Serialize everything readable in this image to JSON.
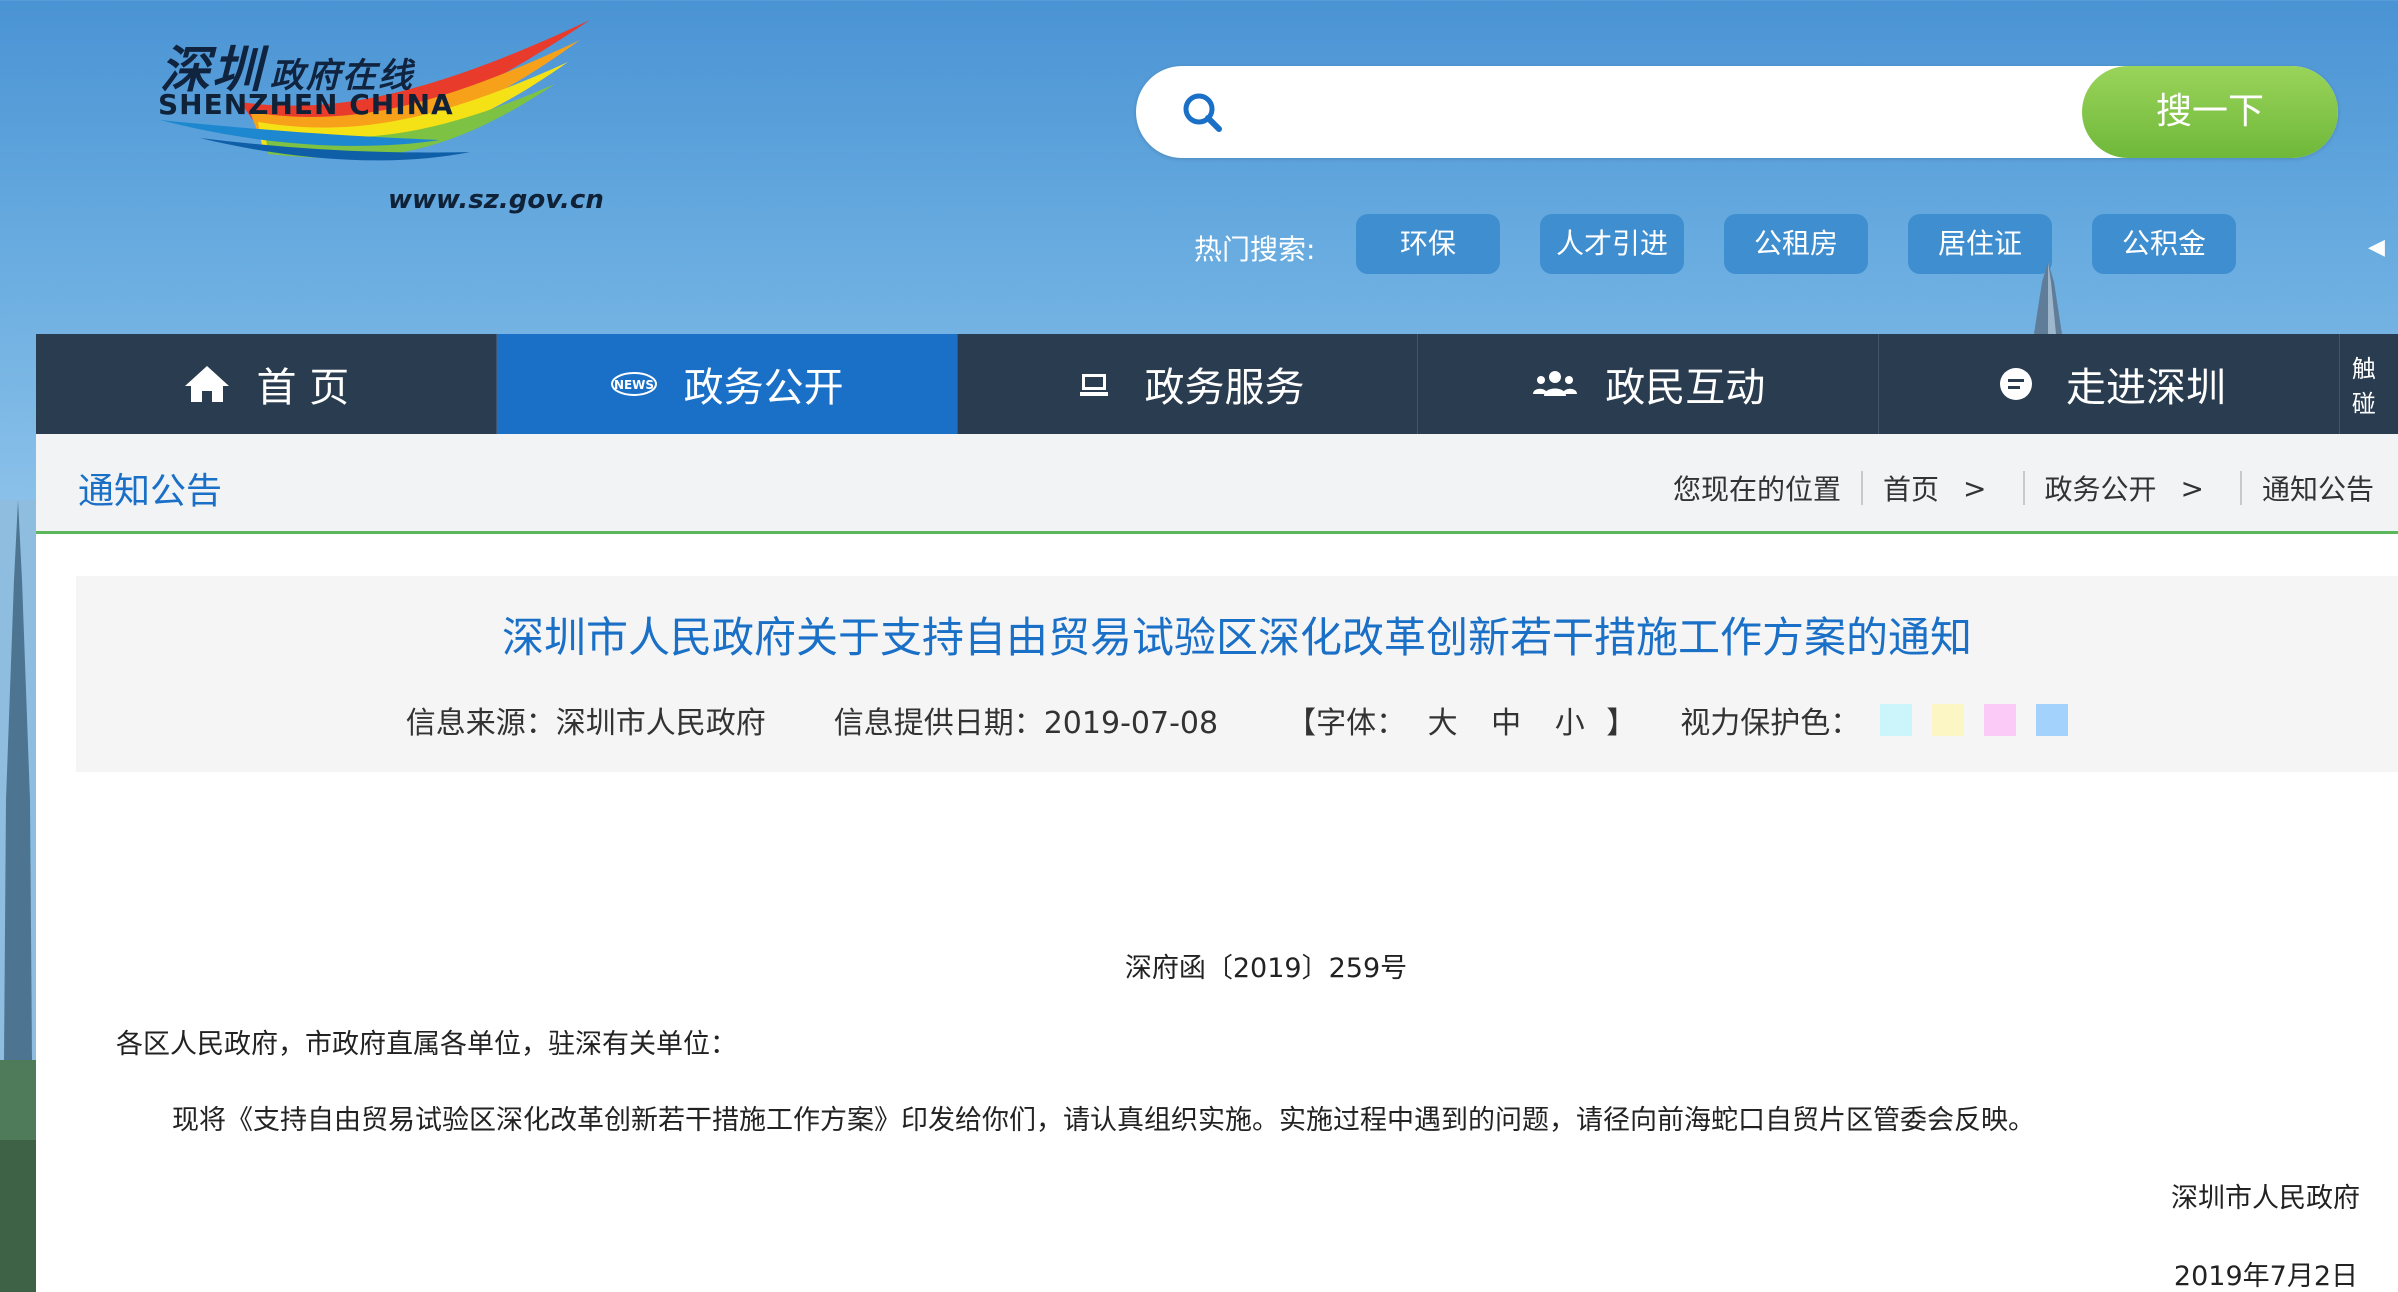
{
  "logo": {
    "cn_name": "深圳",
    "cn_sub": "政府在线",
    "en_name": "SHENZHEN CHINA",
    "url": "www.sz.gov.cn"
  },
  "search": {
    "placeholder": "",
    "value": "",
    "button_label": "搜一下"
  },
  "hot_search": {
    "label": "热门搜索:",
    "tags": [
      "环保",
      "人才引进",
      "公租房",
      "居住证",
      "公积金"
    ]
  },
  "nav": {
    "items": [
      {
        "label": "首 页",
        "icon": "home-icon"
      },
      {
        "label": "政务公开",
        "icon": "news-icon"
      },
      {
        "label": "政务服务",
        "icon": "monitor-icon"
      },
      {
        "label": "政民互动",
        "icon": "people-icon"
      },
      {
        "label": "走进深圳",
        "icon": "chat-icon"
      }
    ],
    "extra": "触碰"
  },
  "breadcrumb": {
    "section_title": "通知公告",
    "location_label": "您现在的位置",
    "path": [
      "首页",
      "政务公开",
      "通知公告"
    ],
    "separator": ">"
  },
  "article": {
    "title": "深圳市人民政府关于支持自由贸易试验区深化改革创新若干措施工作方案的通知",
    "source": "信息来源：深圳市人民政府",
    "date": "信息提供日期：2019-07-08",
    "font_label_open": "【字体：",
    "font_sizes": [
      "大",
      "中",
      "小"
    ],
    "font_label_close": "】",
    "eye_care_label": "视力保护色：",
    "eye_care_colors": [
      "#ccf5fb",
      "#fcf6c4",
      "#fccaf6",
      "#a3d3fd"
    ],
    "doc_number": "深府函〔2019〕259号",
    "salutation": "各区人民政府，市政府直属各单位，驻深有关单位：",
    "body": "现将《支持自由贸易试验区深化改革创新若干措施工作方案》印发给你们，请认真组织实施。实施过程中遇到的问题，请径向前海蛇口自贸片区管委会反映。",
    "signature": "深圳市人民政府",
    "sign_date": "2019年7月2日"
  },
  "colors": {
    "brand_blue": "#1a6fc7",
    "nav_dark": "#2a3c4f",
    "search_green": "#7cc344",
    "divider_green": "#5ab85b"
  }
}
